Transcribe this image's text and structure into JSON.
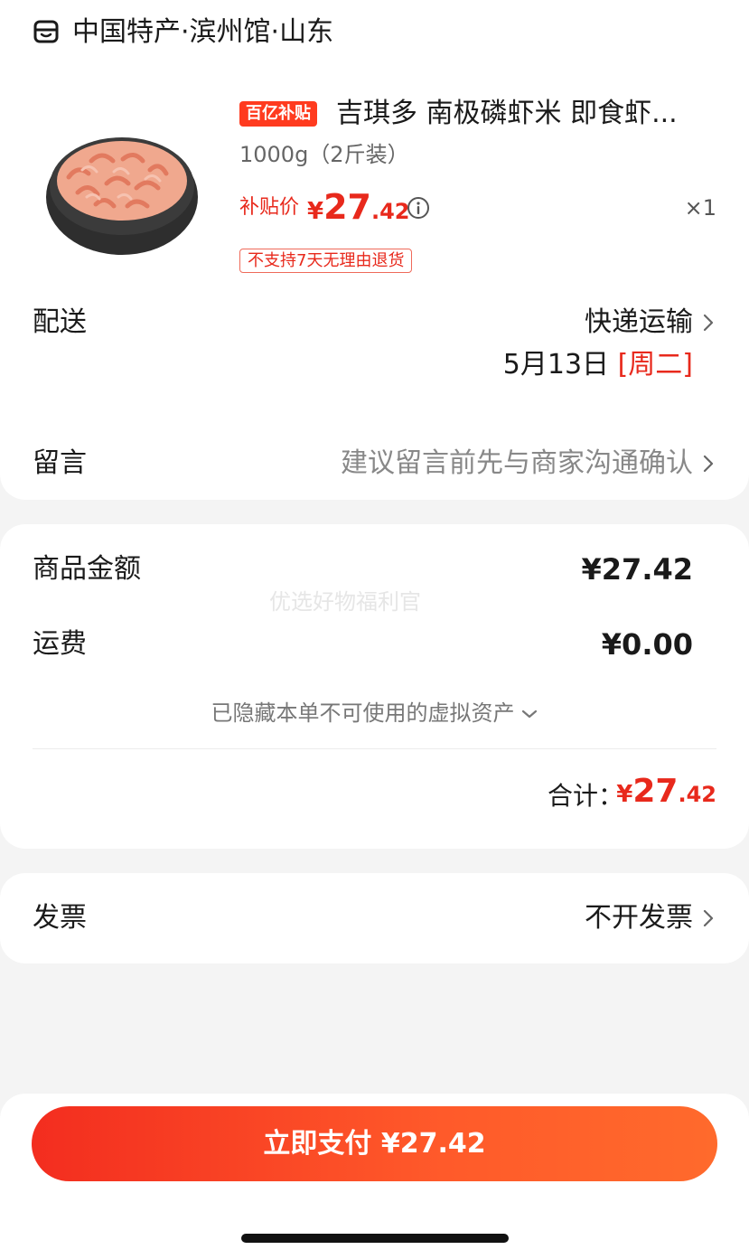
{
  "store": {
    "name": "中国特产·滨州馆·山东",
    "icon": "store-icon"
  },
  "product": {
    "badge": "百亿补贴",
    "title": "吉琪多 南极磷虾米 即食虾...",
    "spec": "1000g（2斤装）",
    "price_label": "补贴价",
    "price_currency": "¥",
    "price_int": "27",
    "price_dec": ".42",
    "quantity": "×1",
    "return_policy": "不支持7天无理由退货"
  },
  "delivery": {
    "label": "配送",
    "method": "快递运输",
    "date": "5月13日",
    "weekday": "[周二]"
  },
  "message": {
    "label": "留言",
    "hint": "建议留言前先与商家沟通确认"
  },
  "summary": {
    "goods_label": "商品金额",
    "goods_value": "¥27.42",
    "watermark": "优选好物福利官",
    "shipping_label": "运费",
    "shipping_value": "¥0.00",
    "hidden_assets": "已隐藏本单不可使用的虚拟资产",
    "total_label": "合计：",
    "total_currency": "¥",
    "total_int": "27",
    "total_dec": ".42"
  },
  "invoice": {
    "label": "发票",
    "value": "不开发票"
  },
  "pay": {
    "label": "立即支付 ¥27.42"
  },
  "colors": {
    "accent": "#e8291c",
    "button_start": "#f32d1f",
    "button_end": "#ff6a2c"
  }
}
